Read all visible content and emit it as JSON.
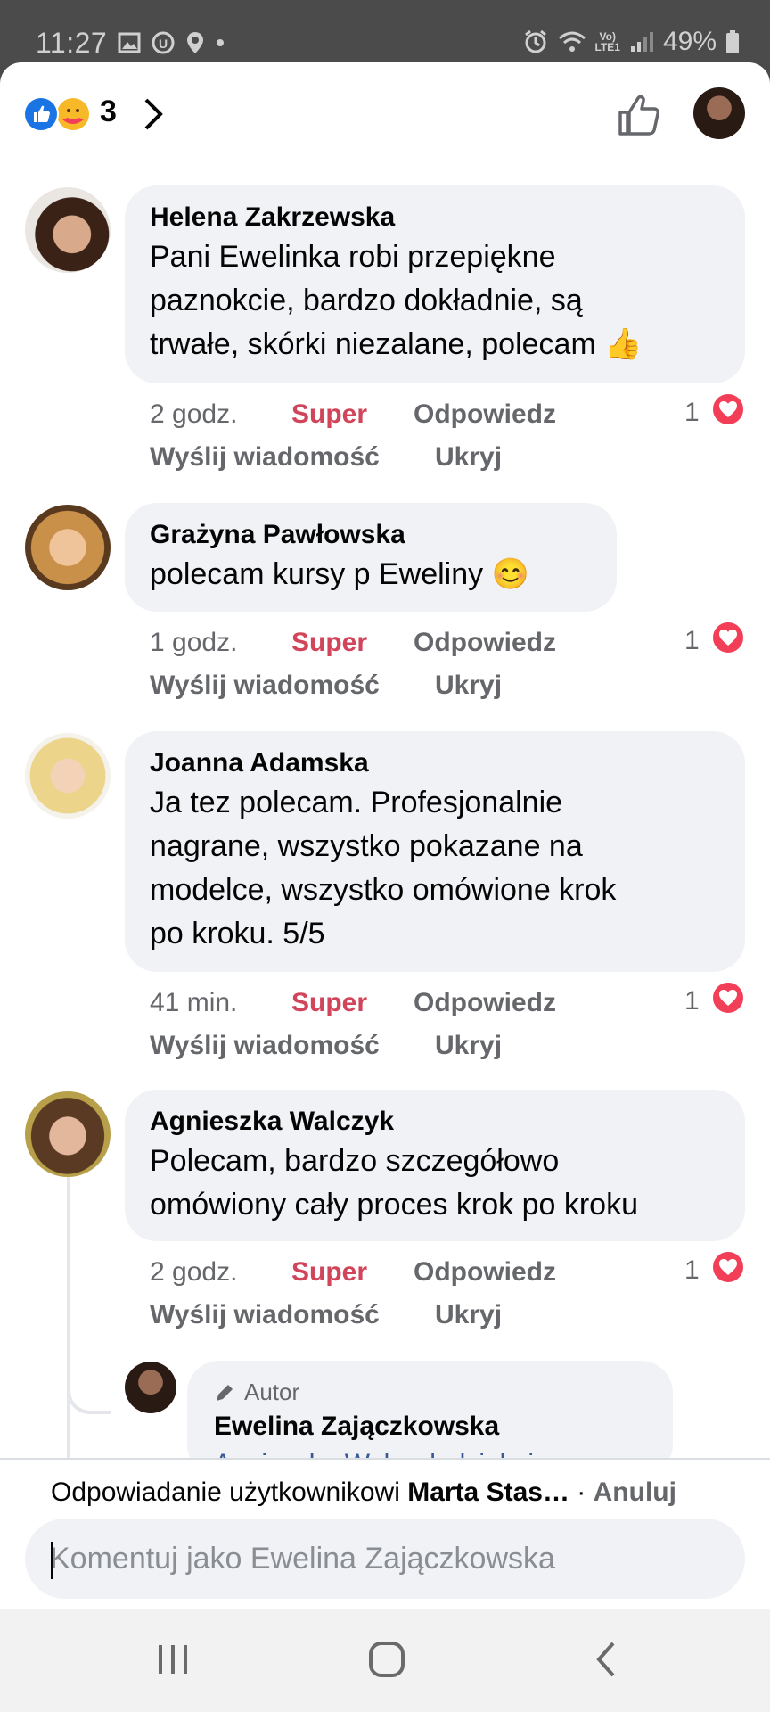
{
  "status_bar": {
    "time": "11:27",
    "battery": "49%",
    "network": "LTE1"
  },
  "reactions": {
    "count": "3",
    "types": [
      "like",
      "care"
    ]
  },
  "comments": [
    {
      "author": "Helena Zakrzewska",
      "text_lines": [
        "Pani Ewelinka robi przepiękne",
        "paznokcie, bardzo dokładnie, są",
        "trwałe, skórki niezalane, polecam 👍"
      ],
      "time": "2 godz.",
      "likes": "1"
    },
    {
      "author": "Grażyna Pawłowska",
      "text_lines": [
        "polecam kursy  p Eweliny 😊"
      ],
      "time": "1 godz.",
      "likes": "1"
    },
    {
      "author": "Joanna Adamska",
      "text_lines": [
        "Ja tez polecam. Profesjonalnie",
        "nagrane, wszystko pokazane na",
        "modelce, wszystko omówione krok",
        "po kroku. 5/5"
      ],
      "time": "41 min.",
      "likes": "1"
    },
    {
      "author": "Agnieszka Walczyk",
      "text_lines": [
        "Polecam, bardzo szczegółowo",
        "omówiony cały proces krok po kroku"
      ],
      "time": "2 godz.",
      "likes": "1"
    }
  ],
  "actions": {
    "react": "Super",
    "reply": "Odpowiedz",
    "message": "Wyślij wiadomość",
    "hide": "Ukryj"
  },
  "reply": {
    "badge": "Autor",
    "author": "Ewelina Zajączkowska",
    "partial_text": "Agnieszka Walczyk dziękuję"
  },
  "composer": {
    "replying_prefix": "Odpowiadanie użytkownikowi",
    "replying_to": "Marta Stas…",
    "separator": " · ",
    "cancel": "Anuluj",
    "placeholder": "Komentuj jako Ewelina Zajączkowska"
  },
  "colors": {
    "accent": "#1b74e4",
    "super": "#d0455a",
    "heart": "#f33e58",
    "bubble": "#f0f2f5"
  }
}
